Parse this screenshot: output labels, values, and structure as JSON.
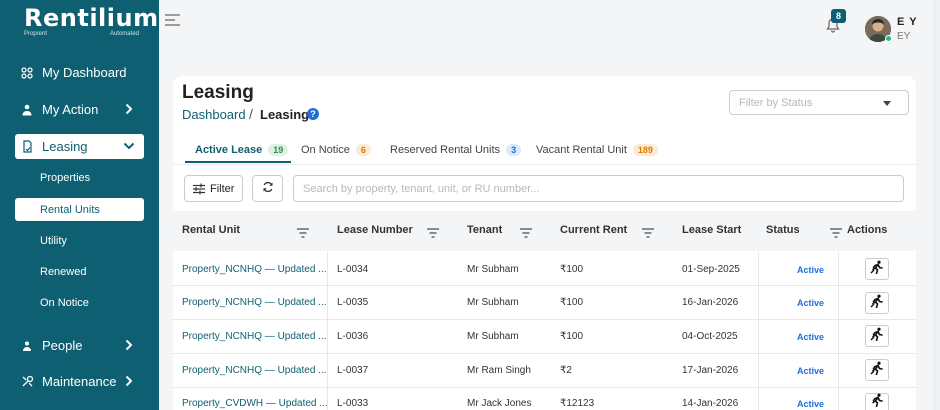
{
  "brand": {
    "name": "Rentilium",
    "tag_left": "Proprent",
    "tag_right": "Automated"
  },
  "sidebar": {
    "items": [
      {
        "label": "My Dashboard",
        "icon": "dashboard-icon"
      },
      {
        "label": "My Action",
        "icon": "action-icon"
      },
      {
        "label": "Leasing",
        "icon": "leasing-icon"
      },
      {
        "label": "People",
        "icon": "people-icon"
      },
      {
        "label": "Maintenance",
        "icon": "maintenance-icon"
      }
    ],
    "leasing_sub": [
      "Properties",
      "Rental Units",
      "Utility",
      "Renewed",
      "On Notice"
    ]
  },
  "topbar": {
    "notifications": "8",
    "user_initials": "E Y",
    "user_sub": "EY"
  },
  "page": {
    "title": "Leasing",
    "breadcrumb_home": "Dashboard",
    "breadcrumb_sep": "/",
    "breadcrumb_current": "Leasing",
    "help": "?",
    "status_filter_placeholder": "Filter by Status"
  },
  "tabs": [
    {
      "label": "Active Lease",
      "count": "19"
    },
    {
      "label": "On Notice",
      "count": "6"
    },
    {
      "label": "Reserved Rental Units",
      "count": "3"
    },
    {
      "label": "Vacant Rental Unit",
      "count": "189"
    }
  ],
  "toolbar": {
    "filter_label": "Filter",
    "search_placeholder": "Search by property, tenant, unit, or RU number..."
  },
  "table": {
    "columns": [
      "Rental Unit",
      "Lease Number",
      "Tenant",
      "Current Rent",
      "Lease Start",
      "Status",
      "Actions"
    ],
    "rows": [
      {
        "unit": "Property_NCNHQ — Updated ...",
        "lease": "L-0034",
        "tenant": "Mr Subham",
        "rent": "₹100",
        "start": "01-Sep-2025",
        "status": "Active"
      },
      {
        "unit": "Property_NCNHQ — Updated ...",
        "lease": "L-0035",
        "tenant": "Mr Subham",
        "rent": "₹100",
        "start": "16-Jan-2026",
        "status": "Active"
      },
      {
        "unit": "Property_NCNHQ — Updated ...",
        "lease": "L-0036",
        "tenant": "Mr Subham",
        "rent": "₹100",
        "start": "04-Oct-2025",
        "status": "Active"
      },
      {
        "unit": "Property_NCNHQ — Updated ...",
        "lease": "L-0037",
        "tenant": "Mr Ram Singh",
        "rent": "₹2",
        "start": "17-Jan-2026",
        "status": "Active"
      },
      {
        "unit": "Property_CVDWH — Updated ...",
        "lease": "L-0033",
        "tenant": "Mr Jack Jones",
        "rent": "₹12123",
        "start": "14-Jan-2026",
        "status": "Active"
      }
    ]
  },
  "colors": {
    "sidebar": "#0f5f72",
    "accent": "#0f5f72",
    "status_active": "#1e6fd9",
    "badge_green": "#2e8b57",
    "badge_orange": "#e07b00",
    "badge_blue": "#1e6fd9"
  }
}
